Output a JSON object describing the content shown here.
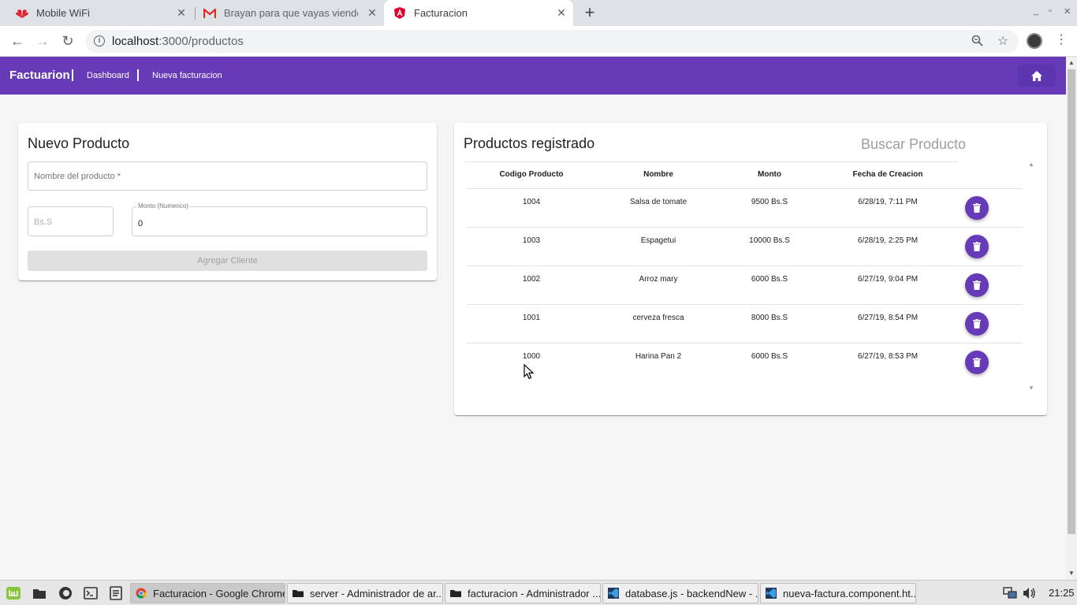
{
  "browser": {
    "tabs": [
      {
        "title": "Mobile WiFi",
        "active": false
      },
      {
        "title": "Brayan para que vayas viendo",
        "active": false
      },
      {
        "title": "Facturacion",
        "active": true
      }
    ],
    "url_host": "localhost",
    "url_path": ":3000/productos"
  },
  "appbar": {
    "brand": "Factuarion",
    "links": [
      "Dashboard",
      "Nueva facturacion"
    ],
    "color": "#673ab7"
  },
  "new_product": {
    "title": "Nuevo Producto",
    "name_placeholder": "Nombre del producto *",
    "currency_placeholder": "Bs.S",
    "amount_label": "Monto (Numerico)",
    "amount_value": "0",
    "submit_label": "Agregar Cliente"
  },
  "products": {
    "title": "Productos registrado",
    "search_placeholder": "Buscar Producto",
    "columns": [
      "Codigo Producto",
      "Nombre",
      "Monto",
      "Fecha de Creacion"
    ],
    "rows": [
      {
        "code": "1004",
        "name": "Salsa de tomate",
        "amount": "9500 Bs.S",
        "date": "6/28/19, 7:11 PM"
      },
      {
        "code": "1003",
        "name": "Espagetui",
        "amount": "10000 Bs.S",
        "date": "6/28/19, 2:25 PM"
      },
      {
        "code": "1002",
        "name": "Arroz mary",
        "amount": "6000 Bs.S",
        "date": "6/27/19, 9:04 PM"
      },
      {
        "code": "1001",
        "name": "cerveza fresca",
        "amount": "8000 Bs.S",
        "date": "6/27/19, 8:54 PM"
      },
      {
        "code": "1000",
        "name": "Harina Pan 2",
        "amount": "6000 Bs.S",
        "date": "6/27/19, 8:53 PM"
      }
    ]
  },
  "taskbar": {
    "tasks": [
      {
        "label": "Facturacion - Google Chrome",
        "active": true
      },
      {
        "label": "server - Administrador de ar...",
        "active": false
      },
      {
        "label": "facturacion - Administrador ...",
        "active": false
      },
      {
        "label": "database.js - backendNew - ...",
        "active": false
      },
      {
        "label": "nueva-factura.component.ht...",
        "active": false
      }
    ],
    "clock": "21:25"
  }
}
